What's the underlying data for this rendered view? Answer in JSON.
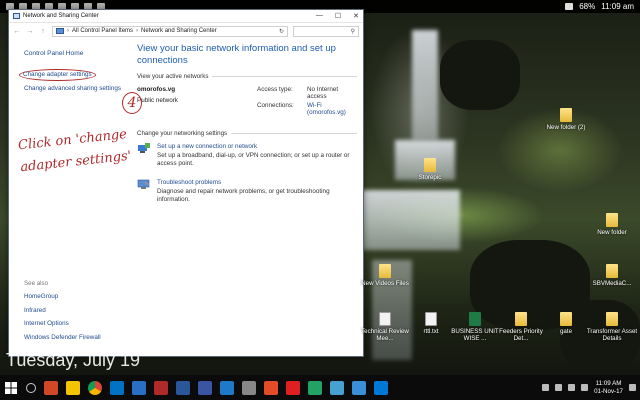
{
  "status_bar": {
    "time": "11:09 am",
    "battery": "68%"
  },
  "window": {
    "title": "Network and Sharing Center",
    "controls": {
      "minimize": "—",
      "maximize": "☐",
      "close": "✕"
    },
    "breadcrumb": [
      "All Control Panel Items",
      "Network and Sharing Center"
    ],
    "nav": {
      "back": "←",
      "forward": "→",
      "up": "↑",
      "refresh": "↻",
      "search": "⚲"
    }
  },
  "sidebar": {
    "home": "Control Panel Home",
    "items": [
      "Change adapter settings",
      "Change advanced sharing settings"
    ]
  },
  "see_also": {
    "header": "See also",
    "links": [
      "HomeGroup",
      "Infrared",
      "Internet Options",
      "Windows Defender Firewall"
    ]
  },
  "main": {
    "heading": "View your basic network information and set up connections",
    "active_networks_title": "View your active networks",
    "network": {
      "name": "omorofos.vg",
      "type": "Public network",
      "access_label": "Access type:",
      "access_value": "No Internet access",
      "connections_label": "Connections:",
      "connection_value": "Wi-Fi (omorofos.vg)"
    },
    "settings_title": "Change your networking settings",
    "tasks": [
      {
        "link": "Set up a new connection or network",
        "desc": "Set up a broadband, dial-up, or VPN connection; or set up a router or access point."
      },
      {
        "link": "Troubleshoot problems",
        "desc": "Diagnose and repair network problems, or get troubleshooting information."
      }
    ]
  },
  "annotation": {
    "number": "4",
    "text": "Click on 'change adapter settings'"
  },
  "desktop": {
    "date": "Tuesday, July 19",
    "icons": [
      "New folder (2)",
      "Storepic",
      "New folder",
      "New Videos Files",
      "SBVMediaC...",
      "Technical Review Mee...",
      "rttl.txt",
      "BUSINESS UNIT WISE ...",
      "Feeders Priority Det...",
      "gate",
      "Transformer Asset Details"
    ]
  },
  "taskbar": {
    "time": "11:09 AM",
    "date": "01-Nov-17"
  },
  "colors": {
    "link": "#1f4b8f",
    "heading": "#1e5fb0",
    "annotation": "#b02a2a",
    "taskbar": "#0b0b0c"
  }
}
